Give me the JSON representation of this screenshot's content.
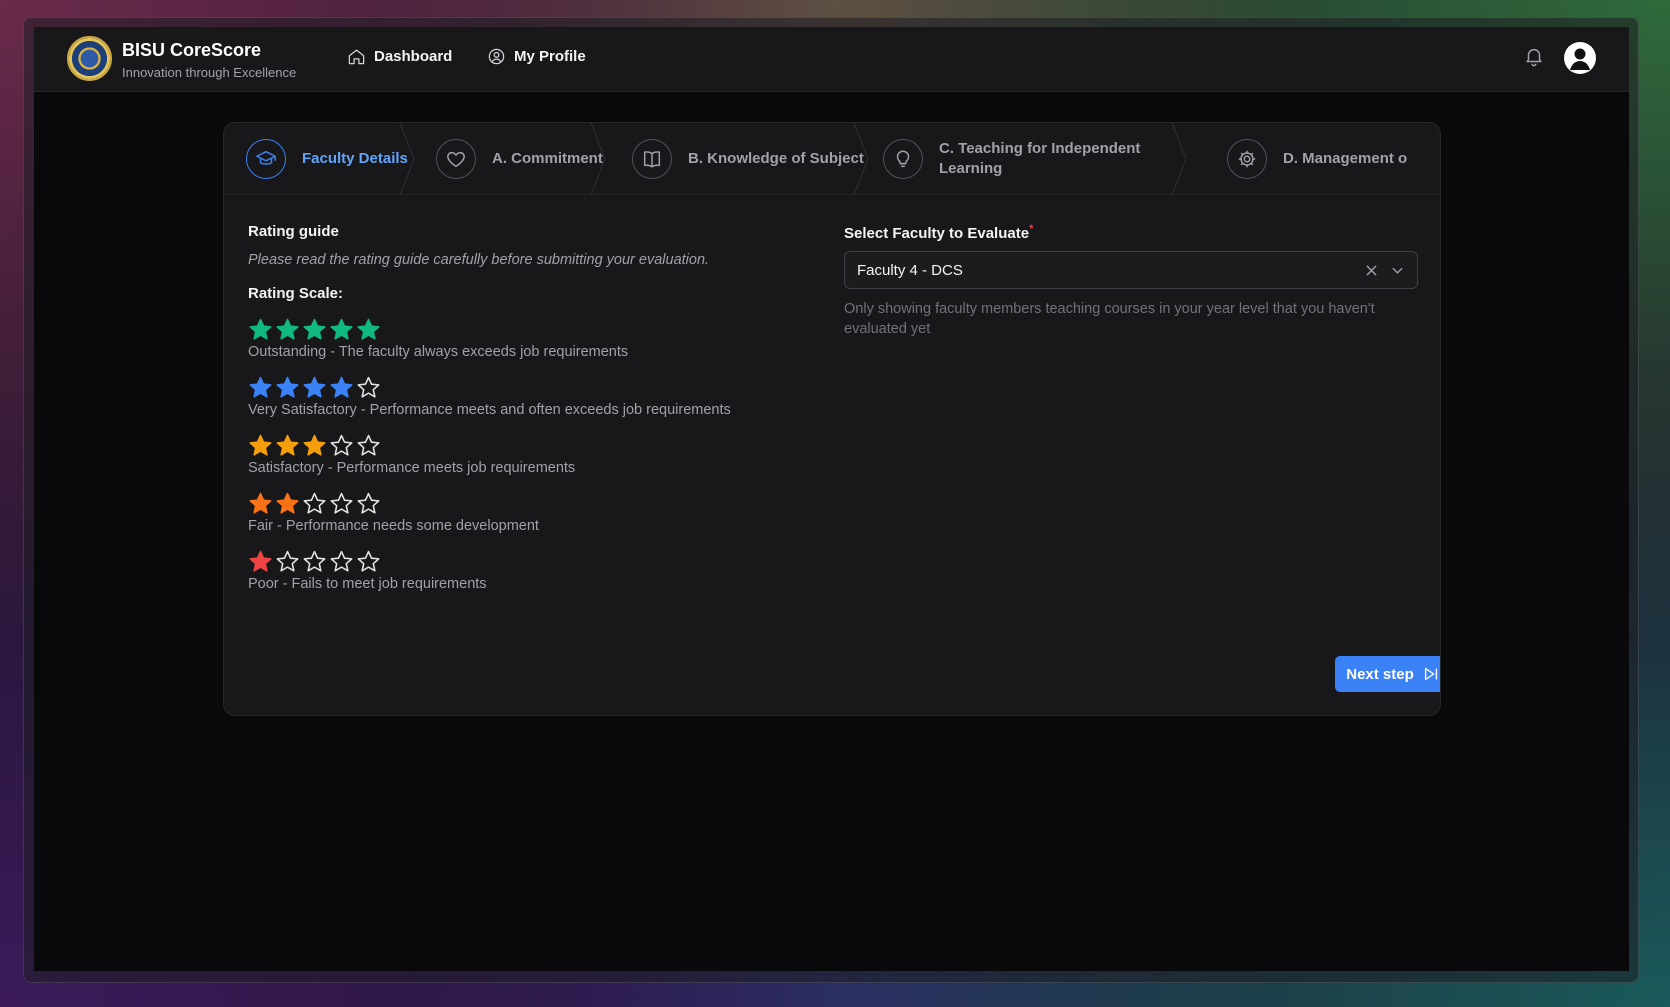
{
  "header": {
    "brand_title": "BISU CoreScore",
    "brand_subtitle": "Innovation through Excellence",
    "nav": [
      {
        "label": "Dashboard",
        "icon": "home-icon"
      },
      {
        "label": "My Profile",
        "icon": "user-circle-icon"
      }
    ]
  },
  "stepper": {
    "steps": [
      {
        "label": "Faculty Details",
        "icon": "graduation-cap-icon",
        "active": true
      },
      {
        "label": "A. Commitment",
        "icon": "heart-icon",
        "active": false
      },
      {
        "label": "B. Knowledge of Subject",
        "icon": "book-icon",
        "active": false
      },
      {
        "label": "C. Teaching for Independent Learning",
        "label_line1": "C. Teaching for Independent",
        "label_line2": "Learning",
        "icon": "lightbulb-icon",
        "active": false
      },
      {
        "label": "D. Management o",
        "icon": "gear-icon",
        "active": false
      }
    ]
  },
  "rating_guide": {
    "title": "Rating guide",
    "note": "Please read the rating guide carefully before submitting your evaluation.",
    "scale_title": "Rating Scale:",
    "levels": [
      {
        "stars": 5,
        "color": "#10b981",
        "description": "Outstanding - The faculty always exceeds job requirements"
      },
      {
        "stars": 4,
        "color": "#3b82f6",
        "description": "Very Satisfactory - Performance meets and often exceeds job requirements"
      },
      {
        "stars": 3,
        "color": "#f59e0b",
        "description": "Satisfactory - Performance meets job requirements"
      },
      {
        "stars": 2,
        "color": "#f97316",
        "description": "Fair - Performance needs some development"
      },
      {
        "stars": 1,
        "color": "#ef4444",
        "description": "Poor - Fails to meet job requirements"
      }
    ]
  },
  "faculty_select": {
    "label": "Select Faculty to Evaluate",
    "required_mark": "*",
    "value": "Faculty 4 - DCS",
    "hint": "Only showing faculty members teaching courses in your year level that you haven't evaluated yet"
  },
  "actions": {
    "next_label": "Next step"
  },
  "colors": {
    "accent": "#3b82f6",
    "accent_text": "#60a5fa",
    "background": "#09090b",
    "card": "#18181b"
  }
}
